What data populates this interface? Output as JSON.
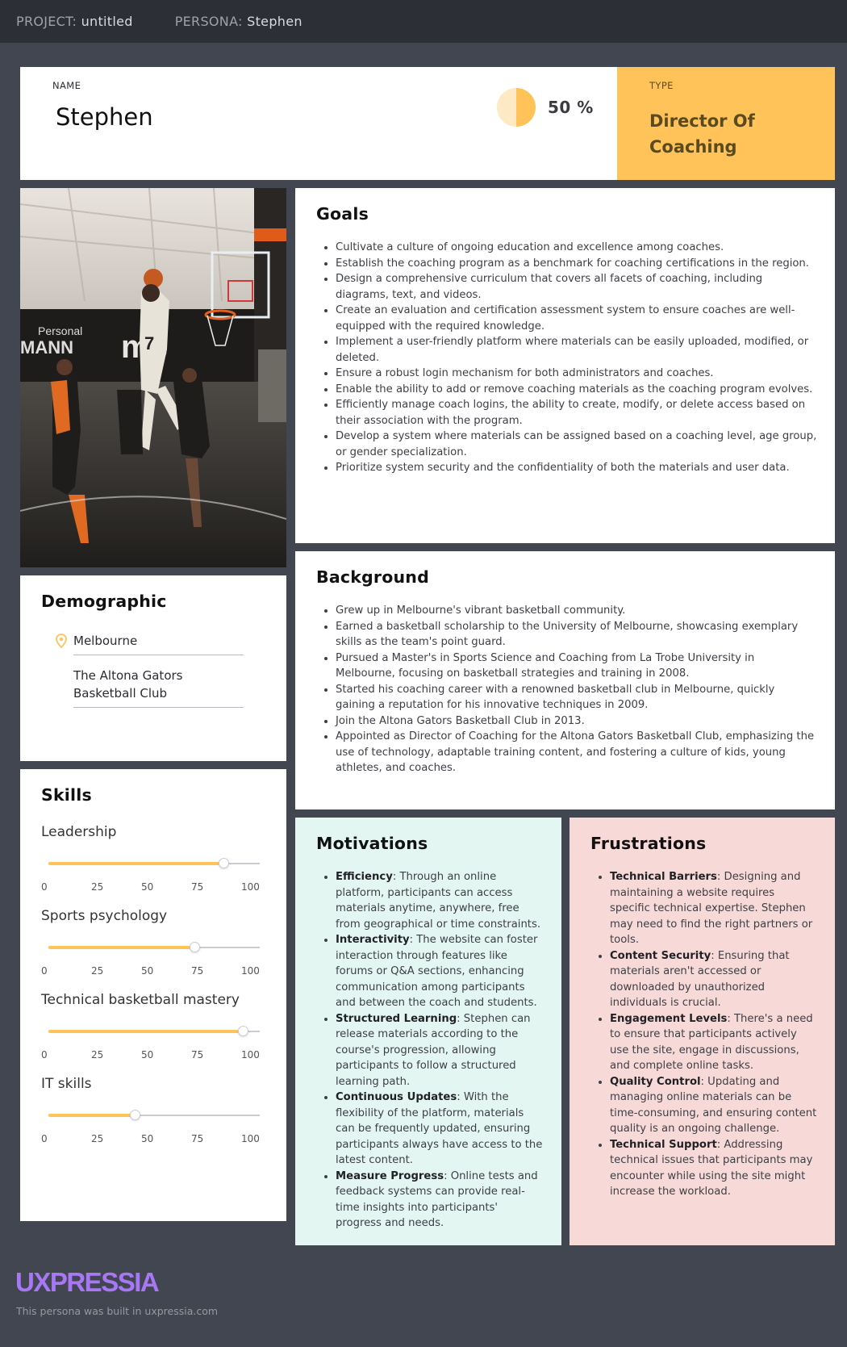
{
  "topbar": {
    "project_label": "PROJECT:",
    "project_value": "untitled",
    "persona_label": "PERSONA:",
    "persona_value": "Stephen"
  },
  "header": {
    "name_label": "NAME",
    "name": "Stephen",
    "completion_value": 50,
    "completion_text": "50 %",
    "type_label": "TYPE",
    "type_value": "Director Of Coaching"
  },
  "goals": {
    "title": "Goals",
    "items": [
      "Cultivate a culture of ongoing education and excellence among coaches.",
      "Establish the coaching program as a benchmark for coaching certifications in the region.",
      "Design a comprehensive curriculum that covers all facets of coaching, including diagrams, text, and videos.",
      "Create an evaluation and certification assessment system to ensure coaches are well-equipped with the required knowledge.",
      "Implement a user-friendly platform where materials can be easily uploaded, modified, or deleted.",
      "Ensure a robust login mechanism for both administrators and coaches.",
      "Enable the ability to add or remove coaching materials as the coaching program evolves.",
      "Efficiently manage coach logins, the ability to create, modify, or delete access based on their association with the program.",
      "Develop a system where materials can be assigned based on a coaching level, age group, or gender specialization.",
      "Prioritize system security and the confidentiality of both the materials and user data."
    ]
  },
  "background": {
    "title": "Background",
    "items": [
      "Grew up in Melbourne's vibrant basketball community.",
      "Earned a basketball scholarship to the University of Melbourne, showcasing exemplary skills as the team's point guard.",
      "Pursued a Master's in Sports Science and Coaching from La Trobe University in Melbourne, focusing on basketball strategies and training in 2008.",
      "Started his coaching career with a renowned basketball club in Melbourne, quickly gaining a reputation for his innovative techniques in 2009.",
      "Join the Altona Gators Basketball Club in 2013.",
      "Appointed as Director of Coaching for the Altona Gators Basketball Club, emphasizing the use of technology, adaptable training content, and fostering a culture of kids, young athletes, and coaches."
    ]
  },
  "demographic": {
    "title": "Demographic",
    "location_icon": "location-pin-icon",
    "location": "Melbourne",
    "organization": "The Altona Gators Basketball Club"
  },
  "skills": {
    "title": "Skills",
    "ticks": [
      "0",
      "25",
      "50",
      "75",
      "100"
    ],
    "items": [
      {
        "name": "Leadership",
        "value": 83
      },
      {
        "name": "Sports psychology",
        "value": 69
      },
      {
        "name": "Technical basketball mastery",
        "value": 92
      },
      {
        "name": "IT skills",
        "value": 41
      }
    ]
  },
  "motivations": {
    "title": "Motivations",
    "items": [
      {
        "term": "Efficiency",
        "text": ": Through an online platform, participants can access materials anytime, anywhere, free from geographical or time constraints."
      },
      {
        "term": "Interactivity",
        "text": ": The website can foster interaction through features like forums or Q&A sections, enhancing communication among participants and between the coach and students."
      },
      {
        "term": "Structured Learning",
        "text": ": Stephen can release materials according to the course's progression, allowing participants to follow a structured learning path."
      },
      {
        "term": "Continuous Updates",
        "text": ": With the flexibility of the platform, materials can be frequently updated, ensuring participants always have access to the latest content."
      },
      {
        "term": "Measure Progress",
        "text": ": Online tests and feedback systems can provide real-time insights into participants' progress and needs."
      }
    ]
  },
  "frustrations": {
    "title": "Frustrations",
    "items": [
      {
        "term": "Technical Barriers",
        "text": ": Designing and maintaining a website requires specific technical expertise. Stephen may need to find the right partners or tools."
      },
      {
        "term": "Content Security",
        "text": ": Ensuring that materials aren't accessed or downloaded by unauthorized individuals is crucial."
      },
      {
        "term": "Engagement Levels",
        "text": ": There's a need to ensure that participants actively use the site, engage in discussions, and complete online tasks."
      },
      {
        "term": "Quality Control",
        "text": ": Updating and managing online materials can be time-consuming, and ensuring content quality is an ongoing challenge."
      },
      {
        "term": "Technical Support",
        "text": ": Addressing technical issues that participants may encounter while using the site might increase the workload."
      }
    ]
  },
  "footer": {
    "brand": "UXPRESSIA",
    "note": "This persona was built in uxpressia.com"
  },
  "colors": {
    "accent": "#ffc35a",
    "background": "#424650",
    "topbar": "#2c2f36",
    "motivations_bg": "#e3f6f1",
    "frustrations_bg": "#f7dad7",
    "brand": "#a877f6"
  }
}
